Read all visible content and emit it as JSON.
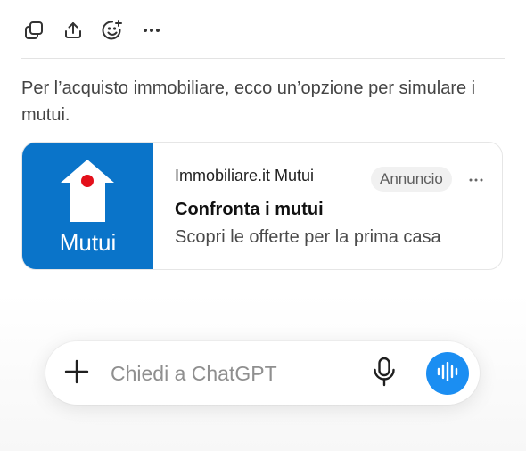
{
  "toolbar": {
    "icons": [
      "copy-icon",
      "share-icon",
      "add-reaction-icon",
      "more-icon"
    ]
  },
  "message": {
    "text": "Per l’acquisto immobiliare, ecco un’opzione per simulare i mutui."
  },
  "ad": {
    "logo_text": "Mutui",
    "source": "Immobiliare.it Mutui",
    "badge": "Annuncio",
    "title": "Confronta i mutui",
    "subtitle": "Scopri le offerte per la prima casa",
    "brand_color": "#0a74c9",
    "logo_dot_color": "#e3101b"
  },
  "composer": {
    "placeholder": "Chiedi a ChatGPT",
    "value": "",
    "voice_button_color": "#1b8ef2"
  }
}
